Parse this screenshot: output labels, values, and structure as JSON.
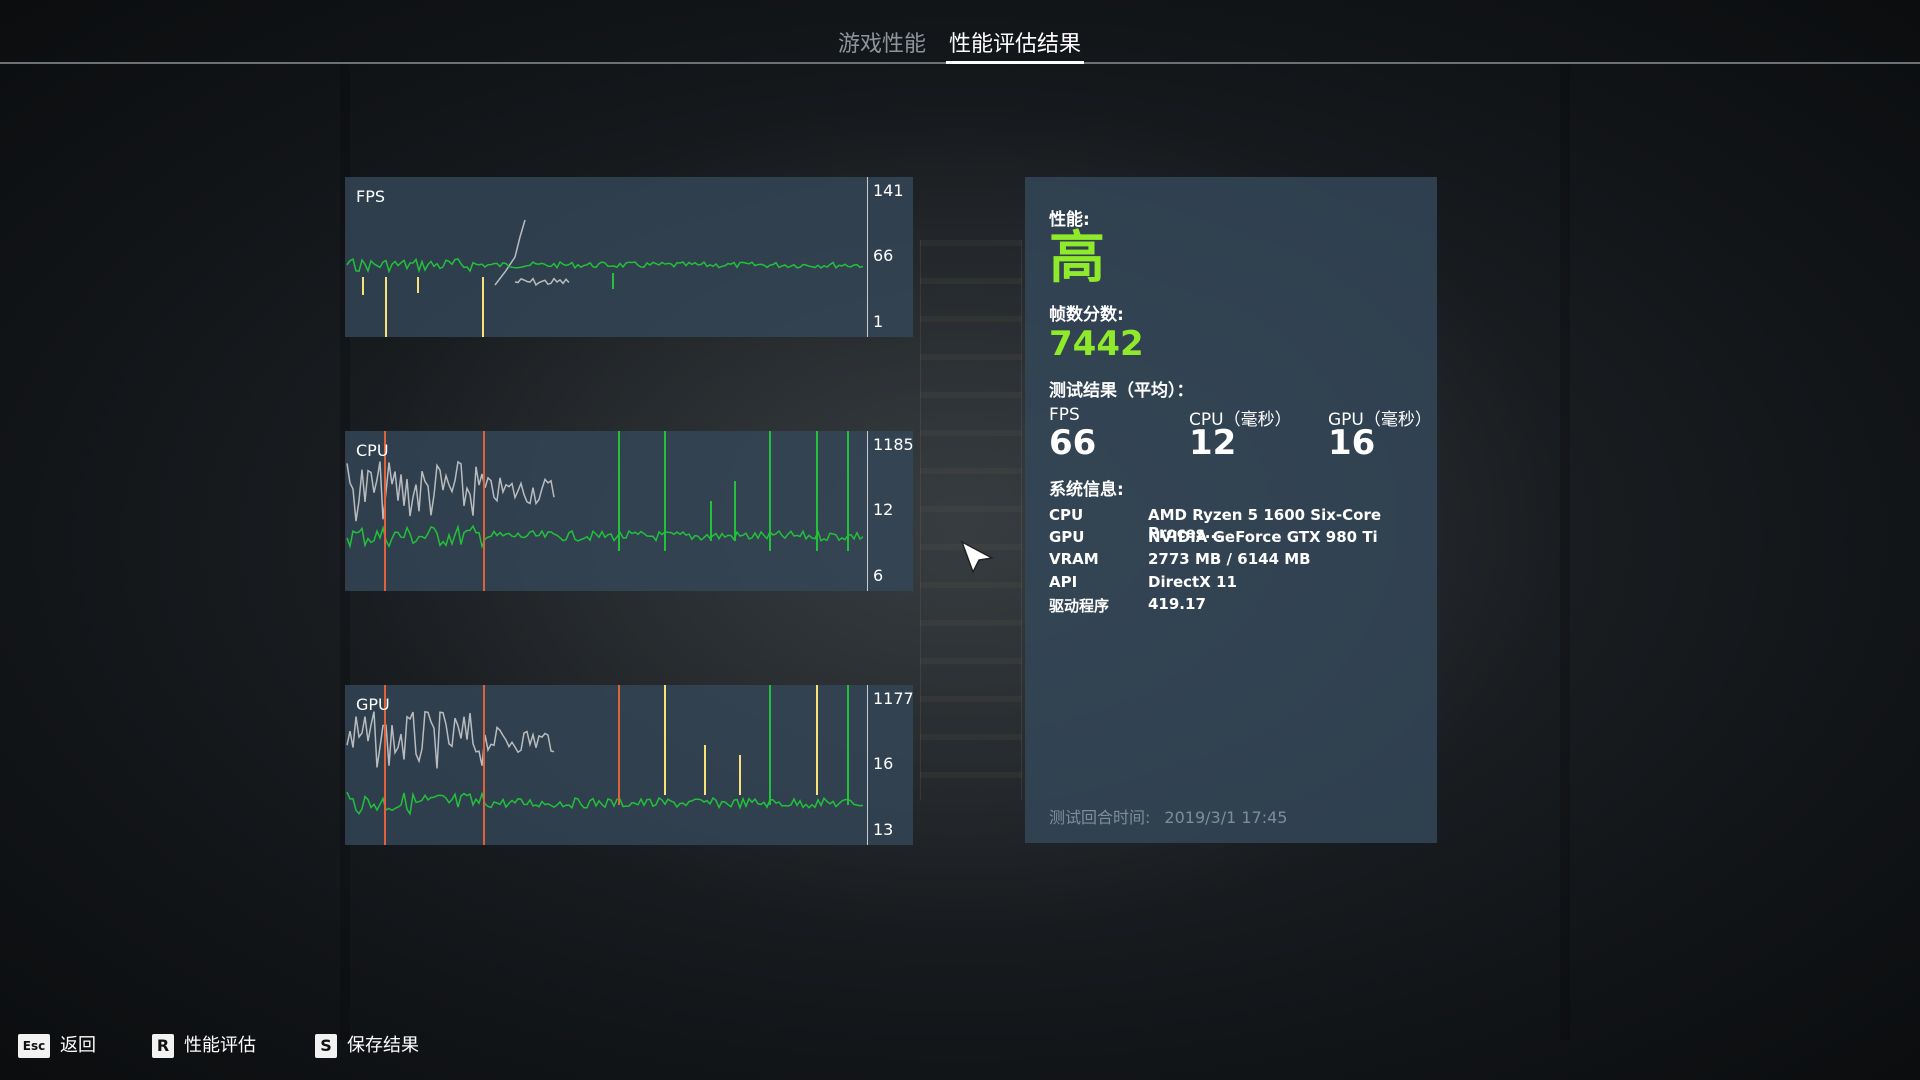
{
  "tabs": [
    {
      "label": "游戏性能",
      "active": false
    },
    {
      "label": "性能评估结果",
      "active": true
    }
  ],
  "charts": [
    {
      "title": "FPS",
      "ticks": [
        "141",
        "66",
        "1"
      ]
    },
    {
      "title": "CPU",
      "ticks": [
        "1185",
        "12",
        "6"
      ]
    },
    {
      "title": "GPU",
      "ticks": [
        "1177",
        "16",
        "13"
      ]
    }
  ],
  "info": {
    "perf_label": "性能:",
    "perf_value": "高",
    "score_label": "帧数分数:",
    "score_value": "7442",
    "results_label": "测试结果（平均）：",
    "stats": [
      {
        "label": "FPS",
        "value": "66"
      },
      {
        "label": "CPU（毫秒）",
        "value": "12"
      },
      {
        "label": "GPU（毫秒）",
        "value": "16"
      }
    ],
    "sysinfo_label": "系统信息:",
    "sysinfo": [
      {
        "key": "CPU",
        "value": "AMD Ryzen 5 1600 Six-Core Proces..."
      },
      {
        "key": "GPU",
        "value": "NVIDIA GeForce GTX 980 Ti"
      },
      {
        "key": "VRAM",
        "value": "2773 MB / 6144 MB"
      },
      {
        "key": "API",
        "value": "DirectX 11"
      },
      {
        "key": "驱动程序",
        "value": "419.17"
      }
    ],
    "timestamp_label": "测试回合时间:",
    "timestamp_value": "2019/3/1 17:45"
  },
  "hints": [
    {
      "key": "Esc",
      "label": "返回"
    },
    {
      "key": "R",
      "label": "性能评估"
    },
    {
      "key": "S",
      "label": "保存结果"
    }
  ],
  "colors": {
    "accent_green": "#8fea2c",
    "line_green": "#22c13a",
    "line_gray": "#b9bcbf",
    "spike_yellow": "#f5e27a",
    "spike_red": "#e0623a",
    "panel": "#344758"
  }
}
